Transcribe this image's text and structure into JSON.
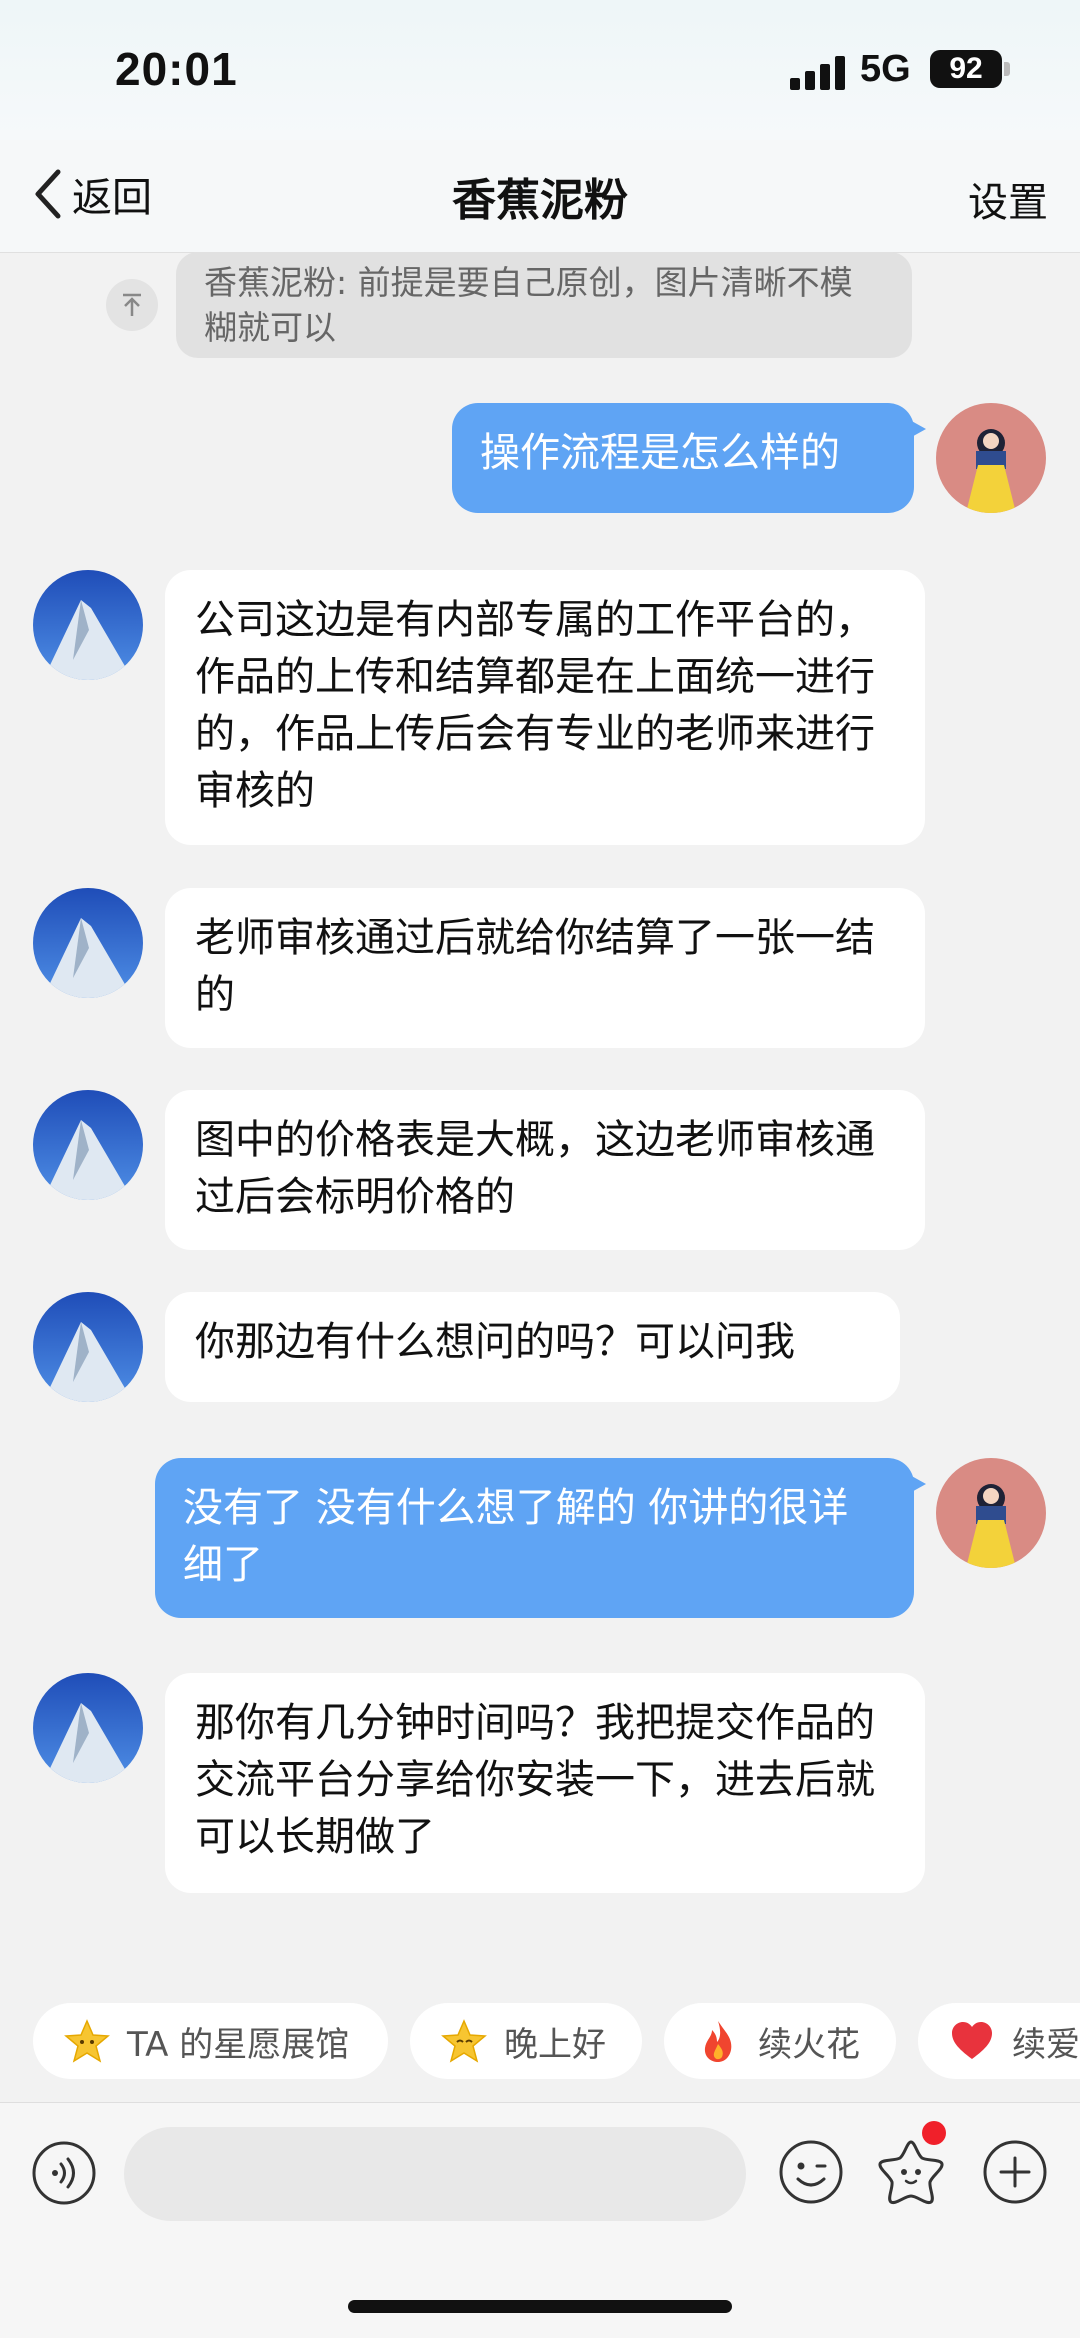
{
  "status": {
    "time": "20:01",
    "network": "5G",
    "battery": "92"
  },
  "nav": {
    "back_label": "返回",
    "title": "香蕉泥粉",
    "settings_label": "设置"
  },
  "pinned": {
    "text": "香蕉泥粉: 前提是要自己原创，图片清晰不模糊就可以",
    "icon": "pin-top-icon"
  },
  "messages": [
    {
      "from": "me",
      "text": "操作流程是怎么样的"
    },
    {
      "from": "other",
      "text": "公司这边是有内部专属的工作平台的，作品的上传和结算都是在上面统一进行的，作品上传后会有专业的老师来进行审核的"
    },
    {
      "from": "other",
      "text": "老师审核通过后就给你结算了一张一结的"
    },
    {
      "from": "other",
      "text": "图中的价格表是大概，这边老师审核通过后会标明价格的"
    },
    {
      "from": "other",
      "text": "你那边有什么想问的吗？可以问我"
    },
    {
      "from": "me",
      "text": "没有了 没有什么想了解的 你讲的很详细了"
    },
    {
      "from": "other",
      "text": "那你有几分钟时间吗？我把提交作品的交流平台分享给你安装一下，进去后就可以长期做了"
    }
  ],
  "quick_actions": [
    {
      "label": "TA 的星愿展馆",
      "icon": "star-face-icon"
    },
    {
      "label": "晚上好",
      "icon": "star-face-icon"
    },
    {
      "label": "续火花",
      "icon": "fire-icon"
    },
    {
      "label": "续爱",
      "icon": "heart-icon"
    }
  ],
  "input": {
    "placeholder": ""
  },
  "colors": {
    "out_bubble": "#5fa4f4",
    "in_bubble": "#ffffff",
    "badge": "#f0202a"
  }
}
